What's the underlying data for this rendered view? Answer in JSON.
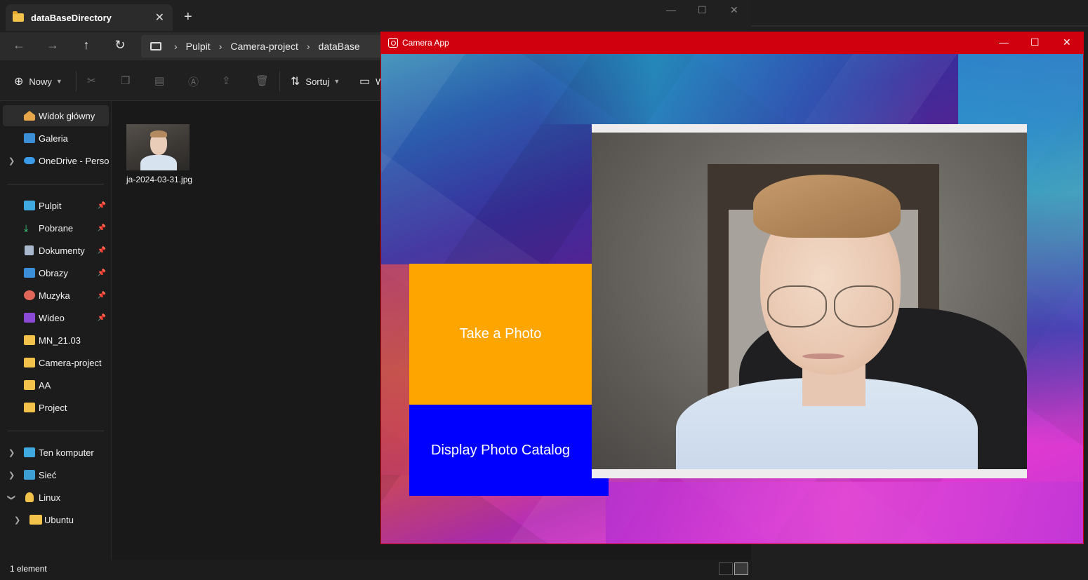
{
  "explorer": {
    "tab_title": "dataBaseDirectory",
    "tab_close": "✕",
    "new_tab": "+",
    "window_controls": {
      "minimize": "—",
      "maximize": "☐",
      "close": "✕"
    },
    "nav": {
      "back": "←",
      "forward": "→",
      "up": "↑",
      "refresh": "↻"
    },
    "breadcrumb": [
      "Pulpit",
      "Camera-project",
      "dataBase"
    ],
    "breadcrumb_sep": "›",
    "commands": {
      "new_label": "Nowy",
      "sort_label": "Sortuj",
      "view_label": "W"
    },
    "sidebar": {
      "quick": [
        {
          "label": "Widok główny",
          "icon": "home-icon",
          "selected": true
        },
        {
          "label": "Galeria",
          "icon": "gallery-icon"
        },
        {
          "label": "OneDrive - Persona",
          "icon": "cloud-icon",
          "expandable": true
        }
      ],
      "pinned": [
        {
          "label": "Pulpit",
          "icon": "desktop-icon",
          "pinned": true
        },
        {
          "label": "Pobrane",
          "icon": "download-icon",
          "pinned": true
        },
        {
          "label": "Dokumenty",
          "icon": "document-icon",
          "pinned": true
        },
        {
          "label": "Obrazy",
          "icon": "pictures-icon",
          "pinned": true
        },
        {
          "label": "Muzyka",
          "icon": "music-icon",
          "pinned": true
        },
        {
          "label": "Wideo",
          "icon": "video-icon",
          "pinned": true
        },
        {
          "label": "MN_21.03",
          "icon": "folder-icon"
        },
        {
          "label": "Camera-project",
          "icon": "folder-icon"
        },
        {
          "label": "AA",
          "icon": "folder-icon"
        },
        {
          "label": "Project",
          "icon": "folder-icon"
        }
      ],
      "system": [
        {
          "label": "Ten komputer",
          "icon": "computer-icon",
          "chevron": ">"
        },
        {
          "label": "Sieć",
          "icon": "network-icon",
          "chevron": ">"
        },
        {
          "label": "Linux",
          "icon": "linux-icon",
          "chevron": "v"
        },
        {
          "label": "Ubuntu",
          "icon": "folder-icon",
          "chevron": ">"
        }
      ]
    },
    "files": [
      {
        "name": "ja-2024-03-31.jpg"
      }
    ],
    "status": {
      "count": "1 element"
    }
  },
  "camera_app": {
    "title": "Camera App",
    "window_controls": {
      "minimize": "—",
      "maximize": "☐",
      "close": "✕"
    },
    "take_photo_label": "Take a Photo",
    "catalog_label": "Display Photo Catalog",
    "colors": {
      "titlebar": "#d0000f",
      "take_button": "#ffa500",
      "catalog_button": "#0000ff"
    }
  }
}
